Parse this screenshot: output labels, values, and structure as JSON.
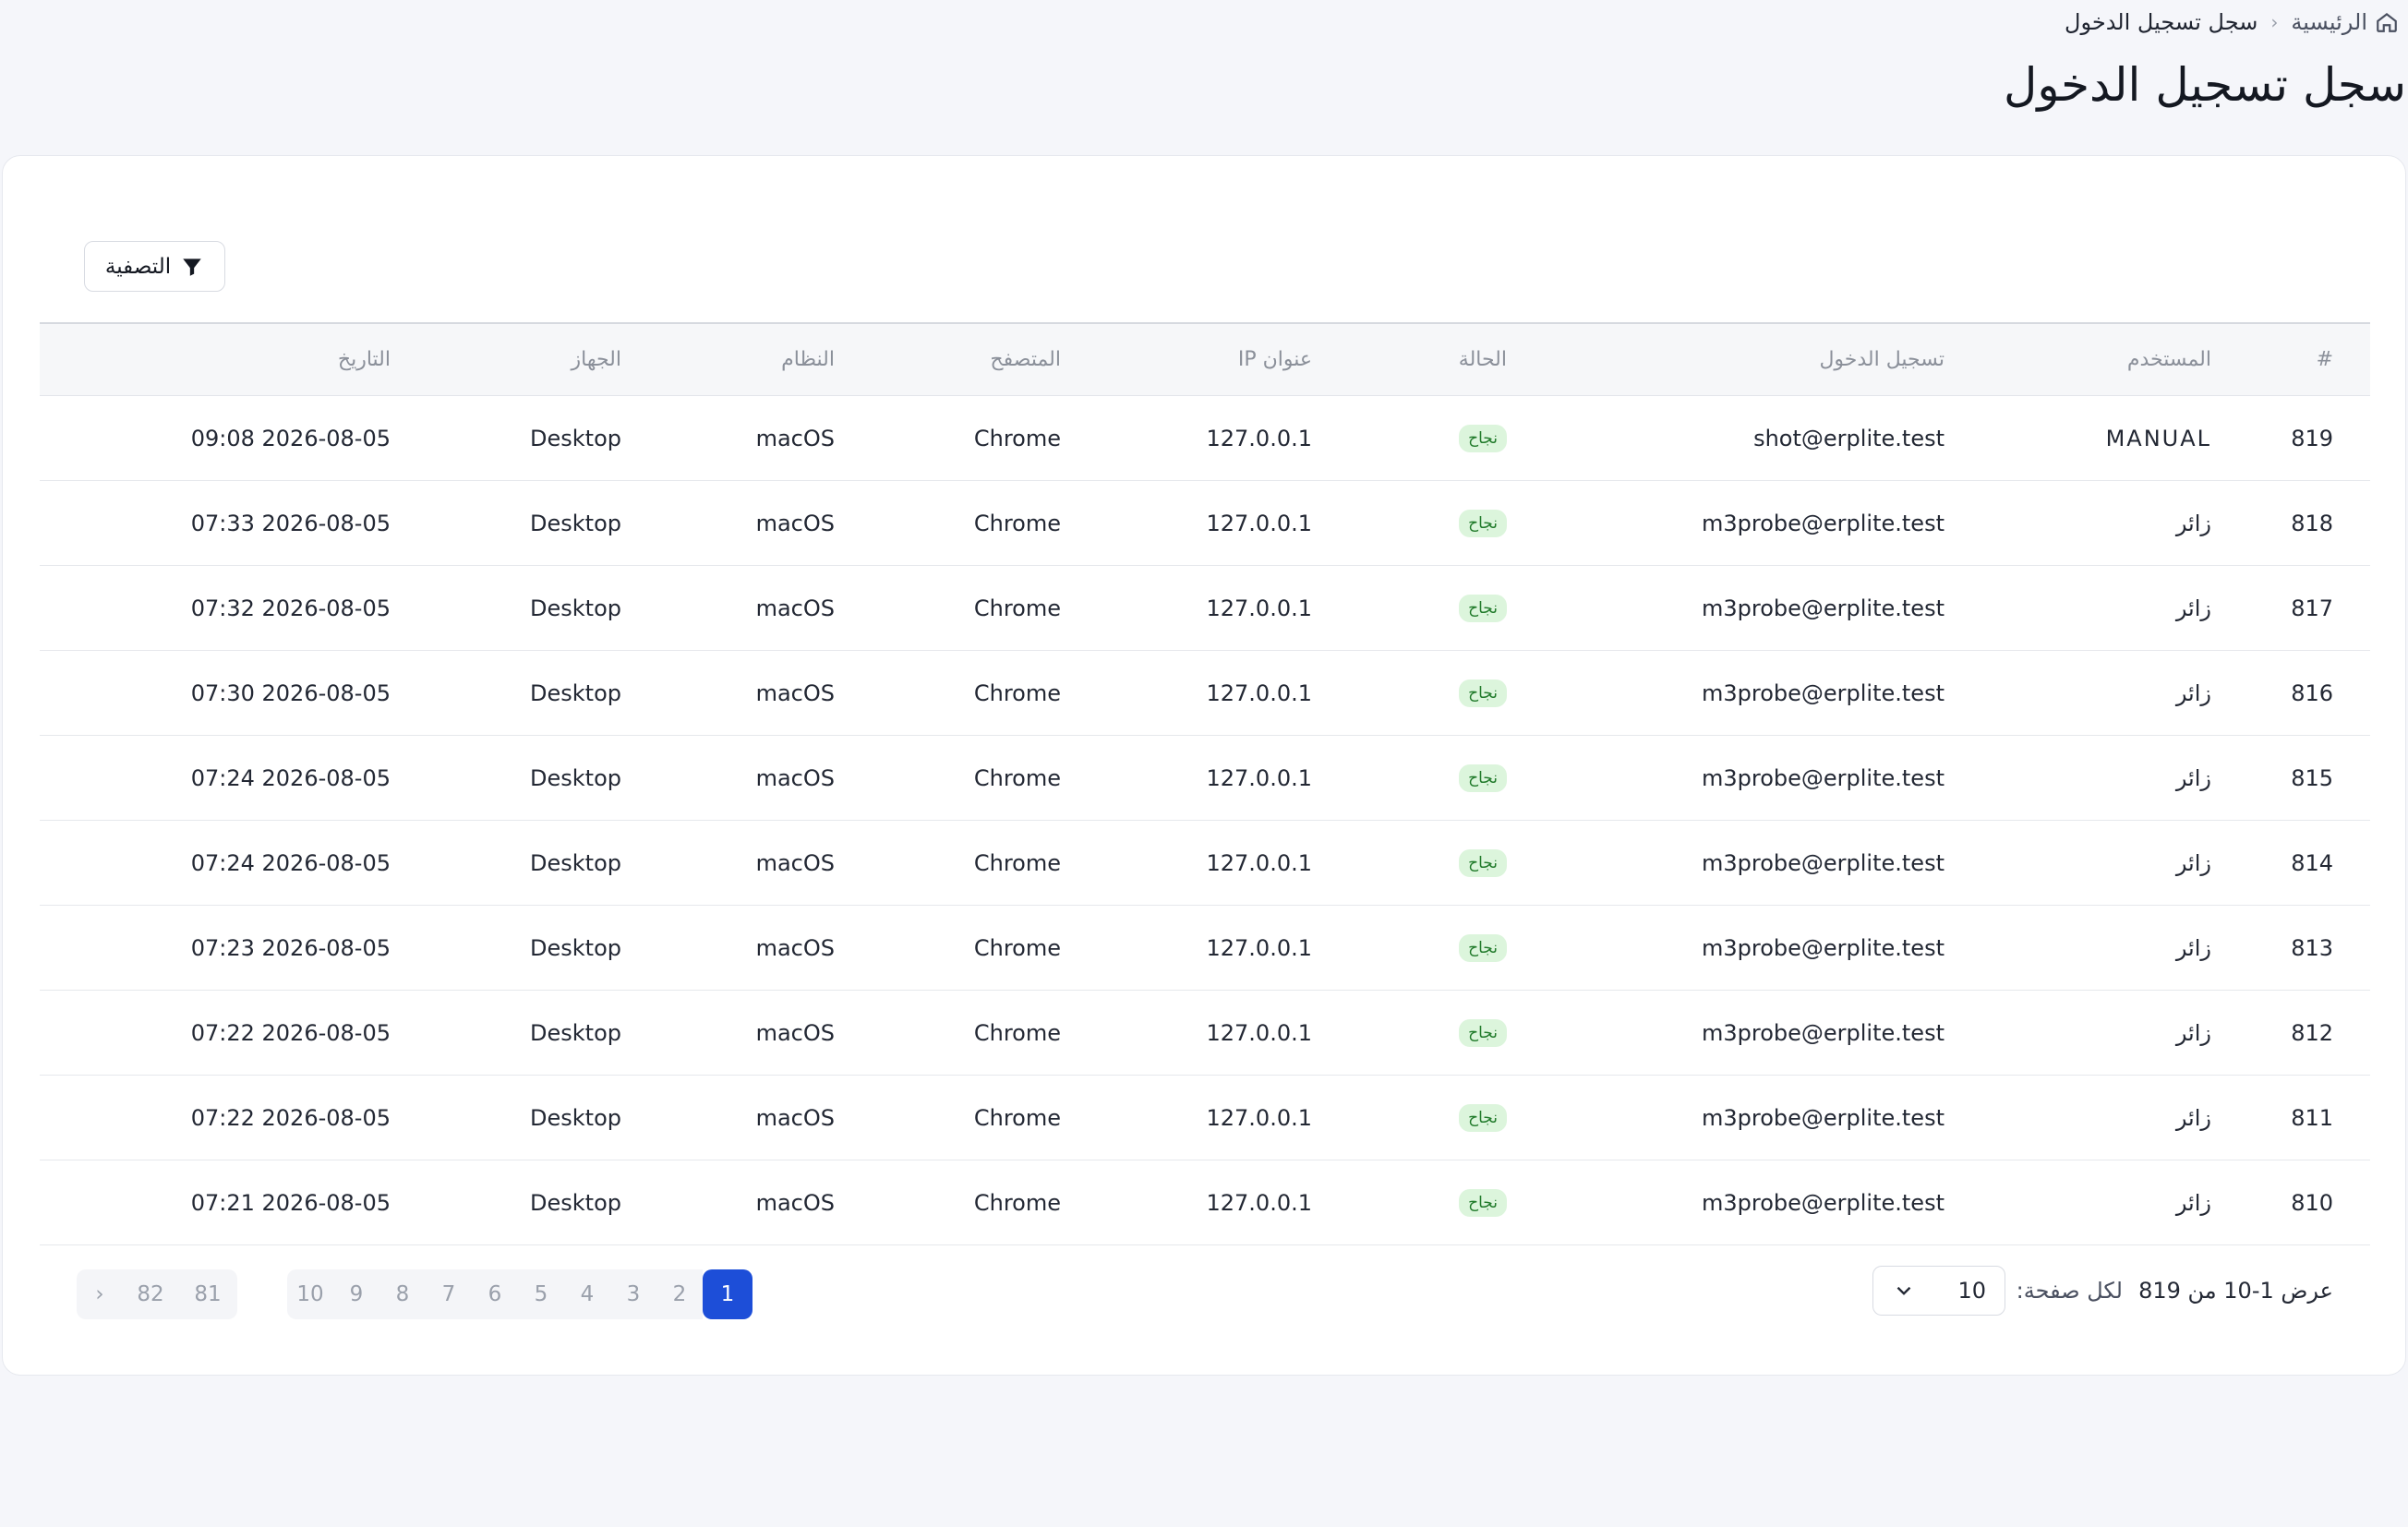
{
  "breadcrumb": {
    "home": "الرئيسية",
    "current": "سجل تسجيل الدخول"
  },
  "page_title": "سجل تسجيل الدخول",
  "filter_button": "التصفية",
  "table": {
    "headers": {
      "num": "#",
      "user": "المستخدم",
      "login": "تسجيل الدخول",
      "status": "الحالة",
      "ip": "عنوان IP",
      "browser": "المتصفح",
      "os": "النظام",
      "device": "الجهاز",
      "date": "التاريخ"
    },
    "rows": [
      {
        "num": "819",
        "user": "MANUAL",
        "login": "shot@erplite.test",
        "status": "نجاح",
        "ip": "127.0.0.1",
        "browser": "Chrome",
        "os": "macOS",
        "device": "Desktop",
        "date": "2026-08-05 09:08"
      },
      {
        "num": "818",
        "user": "زائر",
        "login": "m3probe@erplite.test",
        "status": "نجاح",
        "ip": "127.0.0.1",
        "browser": "Chrome",
        "os": "macOS",
        "device": "Desktop",
        "date": "2026-08-05 07:33"
      },
      {
        "num": "817",
        "user": "زائر",
        "login": "m3probe@erplite.test",
        "status": "نجاح",
        "ip": "127.0.0.1",
        "browser": "Chrome",
        "os": "macOS",
        "device": "Desktop",
        "date": "2026-08-05 07:32"
      },
      {
        "num": "816",
        "user": "زائر",
        "login": "m3probe@erplite.test",
        "status": "نجاح",
        "ip": "127.0.0.1",
        "browser": "Chrome",
        "os": "macOS",
        "device": "Desktop",
        "date": "2026-08-05 07:30"
      },
      {
        "num": "815",
        "user": "زائر",
        "login": "m3probe@erplite.test",
        "status": "نجاح",
        "ip": "127.0.0.1",
        "browser": "Chrome",
        "os": "macOS",
        "device": "Desktop",
        "date": "2026-08-05 07:24"
      },
      {
        "num": "814",
        "user": "زائر",
        "login": "m3probe@erplite.test",
        "status": "نجاح",
        "ip": "127.0.0.1",
        "browser": "Chrome",
        "os": "macOS",
        "device": "Desktop",
        "date": "2026-08-05 07:24"
      },
      {
        "num": "813",
        "user": "زائر",
        "login": "m3probe@erplite.test",
        "status": "نجاح",
        "ip": "127.0.0.1",
        "browser": "Chrome",
        "os": "macOS",
        "device": "Desktop",
        "date": "2026-08-05 07:23"
      },
      {
        "num": "812",
        "user": "زائر",
        "login": "m3probe@erplite.test",
        "status": "نجاح",
        "ip": "127.0.0.1",
        "browser": "Chrome",
        "os": "macOS",
        "device": "Desktop",
        "date": "2026-08-05 07:22"
      },
      {
        "num": "811",
        "user": "زائر",
        "login": "m3probe@erplite.test",
        "status": "نجاح",
        "ip": "127.0.0.1",
        "browser": "Chrome",
        "os": "macOS",
        "device": "Desktop",
        "date": "2026-08-05 07:22"
      },
      {
        "num": "810",
        "user": "زائر",
        "login": "m3probe@erplite.test",
        "status": "نجاح",
        "ip": "127.0.0.1",
        "browser": "Chrome",
        "os": "macOS",
        "device": "Desktop",
        "date": "2026-08-05 07:21"
      }
    ]
  },
  "footer": {
    "showing": "عرض 1-10 من 819",
    "per_page_label": "لكل صفحة:",
    "per_page_value": "10",
    "pages_a": [
      "10",
      "9",
      "8",
      "7",
      "6",
      "5",
      "4",
      "3",
      "2",
      "1"
    ],
    "pages_b": [
      "›",
      "82",
      "81"
    ],
    "active_page": "1"
  },
  "icons": {
    "home": "home-icon",
    "filter": "filter-icon",
    "chevron": "chevron-down-icon"
  },
  "colors": {
    "accent": "#1d4ed8",
    "success_bg": "#dcf5dc",
    "success_text": "#207a2a"
  }
}
